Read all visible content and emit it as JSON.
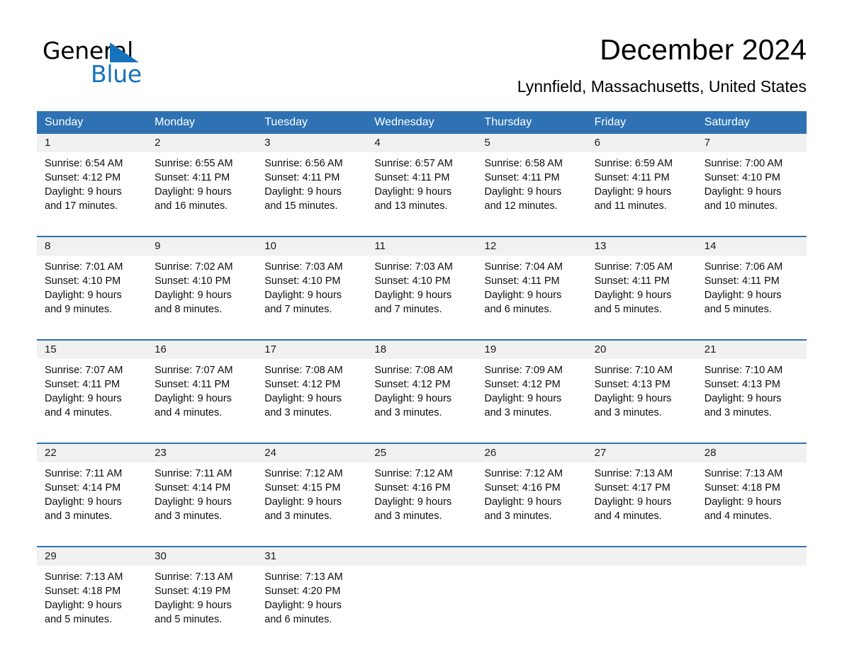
{
  "brand": {
    "name_part1": "General",
    "name_part2": "Blue",
    "logo_icon": "triangle-icon",
    "accent_color": "#1572bd"
  },
  "header": {
    "month_title": "December 2024",
    "location": "Lynnfield, Massachusetts, United States"
  },
  "colors": {
    "header_blue": "#2e72b4",
    "row_band_gray": "#f1f1f1",
    "text_black": "#000000"
  },
  "calendar": {
    "weekday_headers": [
      "Sunday",
      "Monday",
      "Tuesday",
      "Wednesday",
      "Thursday",
      "Friday",
      "Saturday"
    ],
    "weeks": [
      [
        {
          "day": "1",
          "info": "Sunrise: 6:54 AM\nSunset: 4:12 PM\nDaylight: 9 hours\nand 17 minutes."
        },
        {
          "day": "2",
          "info": "Sunrise: 6:55 AM\nSunset: 4:11 PM\nDaylight: 9 hours\nand 16 minutes."
        },
        {
          "day": "3",
          "info": "Sunrise: 6:56 AM\nSunset: 4:11 PM\nDaylight: 9 hours\nand 15 minutes."
        },
        {
          "day": "4",
          "info": "Sunrise: 6:57 AM\nSunset: 4:11 PM\nDaylight: 9 hours\nand 13 minutes."
        },
        {
          "day": "5",
          "info": "Sunrise: 6:58 AM\nSunset: 4:11 PM\nDaylight: 9 hours\nand 12 minutes."
        },
        {
          "day": "6",
          "info": "Sunrise: 6:59 AM\nSunset: 4:11 PM\nDaylight: 9 hours\nand 11 minutes."
        },
        {
          "day": "7",
          "info": "Sunrise: 7:00 AM\nSunset: 4:10 PM\nDaylight: 9 hours\nand 10 minutes."
        }
      ],
      [
        {
          "day": "8",
          "info": "Sunrise: 7:01 AM\nSunset: 4:10 PM\nDaylight: 9 hours\nand 9 minutes."
        },
        {
          "day": "9",
          "info": "Sunrise: 7:02 AM\nSunset: 4:10 PM\nDaylight: 9 hours\nand 8 minutes."
        },
        {
          "day": "10",
          "info": "Sunrise: 7:03 AM\nSunset: 4:10 PM\nDaylight: 9 hours\nand 7 minutes."
        },
        {
          "day": "11",
          "info": "Sunrise: 7:03 AM\nSunset: 4:10 PM\nDaylight: 9 hours\nand 7 minutes."
        },
        {
          "day": "12",
          "info": "Sunrise: 7:04 AM\nSunset: 4:11 PM\nDaylight: 9 hours\nand 6 minutes."
        },
        {
          "day": "13",
          "info": "Sunrise: 7:05 AM\nSunset: 4:11 PM\nDaylight: 9 hours\nand 5 minutes."
        },
        {
          "day": "14",
          "info": "Sunrise: 7:06 AM\nSunset: 4:11 PM\nDaylight: 9 hours\nand 5 minutes."
        }
      ],
      [
        {
          "day": "15",
          "info": "Sunrise: 7:07 AM\nSunset: 4:11 PM\nDaylight: 9 hours\nand 4 minutes."
        },
        {
          "day": "16",
          "info": "Sunrise: 7:07 AM\nSunset: 4:11 PM\nDaylight: 9 hours\nand 4 minutes."
        },
        {
          "day": "17",
          "info": "Sunrise: 7:08 AM\nSunset: 4:12 PM\nDaylight: 9 hours\nand 3 minutes."
        },
        {
          "day": "18",
          "info": "Sunrise: 7:08 AM\nSunset: 4:12 PM\nDaylight: 9 hours\nand 3 minutes."
        },
        {
          "day": "19",
          "info": "Sunrise: 7:09 AM\nSunset: 4:12 PM\nDaylight: 9 hours\nand 3 minutes."
        },
        {
          "day": "20",
          "info": "Sunrise: 7:10 AM\nSunset: 4:13 PM\nDaylight: 9 hours\nand 3 minutes."
        },
        {
          "day": "21",
          "info": "Sunrise: 7:10 AM\nSunset: 4:13 PM\nDaylight: 9 hours\nand 3 minutes."
        }
      ],
      [
        {
          "day": "22",
          "info": "Sunrise: 7:11 AM\nSunset: 4:14 PM\nDaylight: 9 hours\nand 3 minutes."
        },
        {
          "day": "23",
          "info": "Sunrise: 7:11 AM\nSunset: 4:14 PM\nDaylight: 9 hours\nand 3 minutes."
        },
        {
          "day": "24",
          "info": "Sunrise: 7:12 AM\nSunset: 4:15 PM\nDaylight: 9 hours\nand 3 minutes."
        },
        {
          "day": "25",
          "info": "Sunrise: 7:12 AM\nSunset: 4:16 PM\nDaylight: 9 hours\nand 3 minutes."
        },
        {
          "day": "26",
          "info": "Sunrise: 7:12 AM\nSunset: 4:16 PM\nDaylight: 9 hours\nand 3 minutes."
        },
        {
          "day": "27",
          "info": "Sunrise: 7:13 AM\nSunset: 4:17 PM\nDaylight: 9 hours\nand 4 minutes."
        },
        {
          "day": "28",
          "info": "Sunrise: 7:13 AM\nSunset: 4:18 PM\nDaylight: 9 hours\nand 4 minutes."
        }
      ],
      [
        {
          "day": "29",
          "info": "Sunrise: 7:13 AM\nSunset: 4:18 PM\nDaylight: 9 hours\nand 5 minutes."
        },
        {
          "day": "30",
          "info": "Sunrise: 7:13 AM\nSunset: 4:19 PM\nDaylight: 9 hours\nand 5 minutes."
        },
        {
          "day": "31",
          "info": "Sunrise: 7:13 AM\nSunset: 4:20 PM\nDaylight: 9 hours\nand 6 minutes."
        },
        {
          "day": "",
          "info": ""
        },
        {
          "day": "",
          "info": ""
        },
        {
          "day": "",
          "info": ""
        },
        {
          "day": "",
          "info": ""
        }
      ]
    ]
  }
}
